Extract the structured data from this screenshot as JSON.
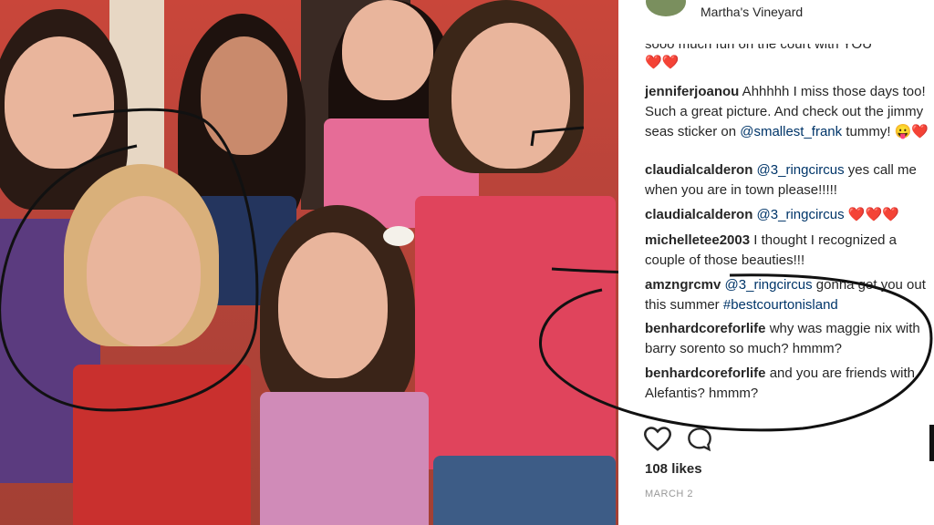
{
  "post": {
    "location": "Martha's Vineyard",
    "truncated_comment": "sooo much fun on the court with YOU",
    "hearts": "❤️❤️",
    "comments": [
      {
        "user": "jenniferjoanou",
        "text_before": " Ahhhhh I miss those days too! Such a great picture. And check out the jimmy seas sticker on ",
        "mention": "@smallest_frank",
        "text_after": " tummy! 😛❤️"
      },
      {
        "user": "claudialcalderon",
        "mention": " @3_ringcircus",
        "text_after": " yes call me when you are in town please!!!!!"
      },
      {
        "user": "claudialcalderon",
        "mention": " @3_ringcircus",
        "text_after": " ❤️❤️❤️"
      },
      {
        "user": "michelletee2003",
        "text_after": " I thought I recognized a couple of those beauties!!!"
      },
      {
        "user": "amzngrcmv",
        "mention": " @3_ringcircus",
        "text_before": "",
        "text_after": " gonna get you out this summer ",
        "hashtag": "#bestcourtonisland"
      },
      {
        "user": "benhardcoreforlife",
        "text_after": " why was maggie nix with barry sorento so much? hmmm?"
      },
      {
        "user": "benhardcoreforlife",
        "text_after": " and you are friends with Alefantis? hmmm?"
      }
    ],
    "likes": "108 likes",
    "date": "MARCH 2"
  },
  "icons": {
    "like": "heart-outline-icon",
    "comment": "comment-bubble-icon"
  }
}
